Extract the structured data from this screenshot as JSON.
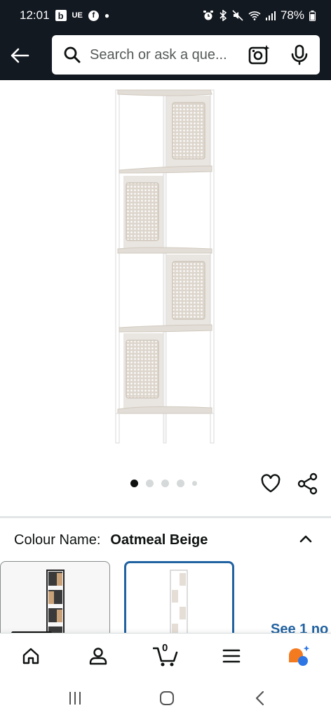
{
  "status_bar": {
    "time": "12:01",
    "b_icon": "b",
    "ue_label": "UE",
    "battery": "78%"
  },
  "search": {
    "placeholder": "Search or ask a que..."
  },
  "product": {
    "carousel_total": 5,
    "carousel_active": 0
  },
  "colour": {
    "label": "Colour Name:",
    "value": "Oatmeal Beige"
  },
  "swatches": {
    "see_more": "See 1 no"
  },
  "bottom_nav": {
    "cart_count": "0"
  },
  "colors": {
    "header_bg": "#131921",
    "selected_border": "#2162a1",
    "link": "#2162a1",
    "rufus_orange": "#f47a20",
    "rufus_blue": "#2f76e5"
  },
  "icons": [
    "back-arrow-icon",
    "search-icon",
    "camera-lens-icon",
    "microphone-icon",
    "heart-icon",
    "share-icon",
    "chevron-up-icon",
    "home-icon",
    "account-icon",
    "cart-icon",
    "menu-icon",
    "rufus-icon",
    "recents-icon",
    "android-home-icon",
    "android-back-icon"
  ]
}
